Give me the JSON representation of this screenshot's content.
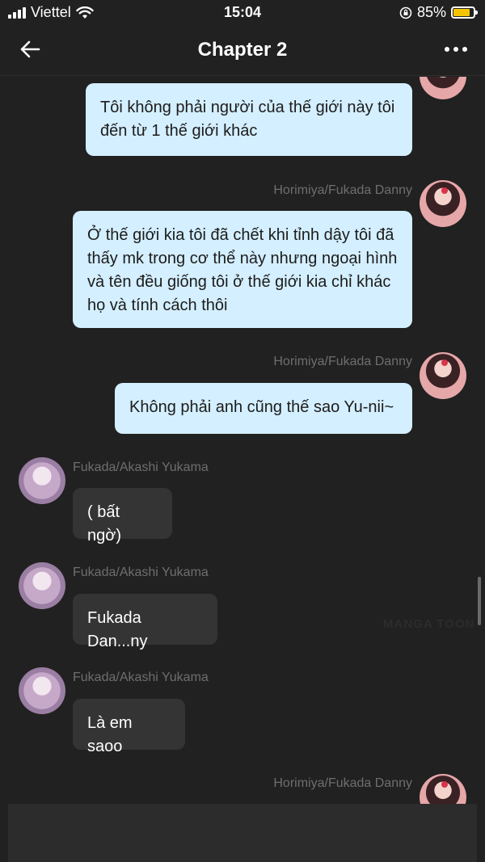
{
  "status_bar": {
    "carrier": "Viettel",
    "time": "15:04",
    "battery_percent": "85%",
    "battery_level": 0.85,
    "icons": [
      "signal-icon",
      "wifi-icon",
      "orientation-lock-icon",
      "battery-icon"
    ]
  },
  "header": {
    "title": "Chapter 2",
    "icons": [
      "back-arrow-icon",
      "more-options-icon"
    ]
  },
  "messages": [
    {
      "sender": "",
      "text": "Tôi không phải người của thế giới này tôi đến từ 1 thế giới khác",
      "side": "right"
    },
    {
      "sender": "Horimiya/Fukada Danny",
      "text": "Ở thế giới kia tôi đã chết khi tỉnh dậy tôi đã thấy mk trong cơ thể này nhưng ngoại hình và tên đều giống tôi ở thế giới kia chỉ khác họ và tính cách thôi",
      "side": "right"
    },
    {
      "sender": "Horimiya/Fukada Danny",
      "text": "Không phải anh cũng thế sao Yu-nii~",
      "side": "right"
    },
    {
      "sender": "Fukada/Akashi Yukama",
      "text": "( bất ngờ)",
      "side": "left"
    },
    {
      "sender": "Fukada/Akashi Yukama",
      "text": "Fukada Dan...ny",
      "side": "left"
    },
    {
      "sender": "Fukada/Akashi Yukama",
      "text": "Là em saoo",
      "side": "left"
    },
    {
      "sender": "Horimiya/Fukada Danny",
      "text": "",
      "side": "right"
    }
  ],
  "watermark": "MANGA TOON",
  "colors": {
    "background": "#212121",
    "outgoing_bubble": "#d4efff",
    "incoming_bubble": "#343434",
    "sender_name": "#6e6e6e",
    "battery": "#f5c400"
  }
}
